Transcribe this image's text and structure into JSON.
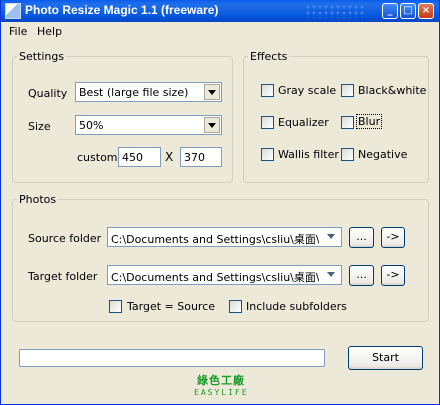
{
  "window": {
    "title": "Photo Resize Magic 1.1 (freeware)"
  },
  "titlebar_buttons": {
    "minimize": "_",
    "maximize": "□",
    "close": "×"
  },
  "menu": {
    "file": "File",
    "help": "Help"
  },
  "settings": {
    "legend": "Settings",
    "quality_label": "Quality",
    "quality_value": "Best (large file size)",
    "size_label": "Size",
    "size_value": "50%",
    "custom_label": "custom:",
    "custom_width": "450",
    "custom_sep": "X",
    "custom_height": "370"
  },
  "effects": {
    "legend": "Effects",
    "grayscale": "Gray scale",
    "blackwhite": "Black&white",
    "equalizer": "Equalizer",
    "blur": "Blur",
    "wallis": "Wallis filter",
    "negative": "Negative"
  },
  "photos": {
    "legend": "Photos",
    "source_label": "Source folder",
    "source_value": "C:\\Documents and Settings\\csliu\\桌面\\待上",
    "target_label": "Target folder",
    "target_value": "C:\\Documents and Settings\\csliu\\桌面\\新资",
    "browse_label": "...",
    "go_label": "->",
    "target_eq_source": "Target = Source",
    "include_subfolders": "Include subfolders"
  },
  "progress": {
    "value": 0
  },
  "start_button": "Start",
  "logo": {
    "cn": "綠色工廠",
    "en": "EASYLIFE"
  },
  "colors": {
    "titlebar": "#0658de",
    "window_bg": "#ece9d8",
    "progress_fill": "#2bb62b",
    "logo": "#1a9a2a"
  }
}
